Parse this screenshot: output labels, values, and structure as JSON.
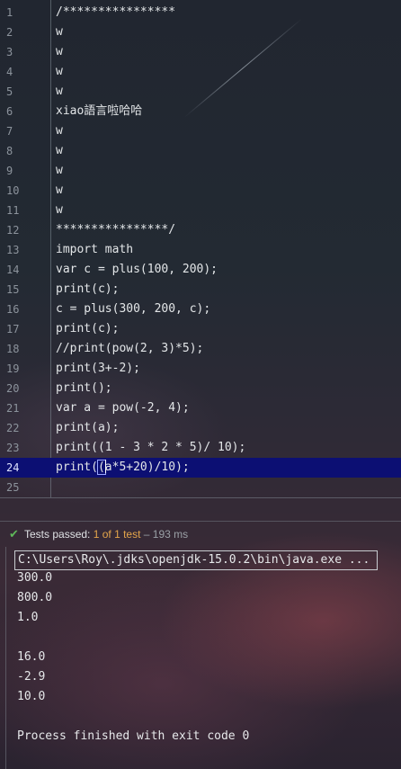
{
  "editor": {
    "current_line": 24,
    "lines": [
      {
        "n": "1",
        "code": "/****************"
      },
      {
        "n": "2",
        "code": "w"
      },
      {
        "n": "3",
        "code": "w"
      },
      {
        "n": "4",
        "code": "w"
      },
      {
        "n": "5",
        "code": "w"
      },
      {
        "n": "6",
        "code": "xiao語言啦哈哈"
      },
      {
        "n": "7",
        "code": "w"
      },
      {
        "n": "8",
        "code": "w"
      },
      {
        "n": "9",
        "code": "w"
      },
      {
        "n": "10",
        "code": "w"
      },
      {
        "n": "11",
        "code": "w"
      },
      {
        "n": "12",
        "code": "****************/"
      },
      {
        "n": "13",
        "code": "import math"
      },
      {
        "n": "14",
        "code": "var c = plus(100, 200);"
      },
      {
        "n": "15",
        "code": "print(c);"
      },
      {
        "n": "16",
        "code": "c = plus(300, 200, c);"
      },
      {
        "n": "17",
        "code": "print(c);"
      },
      {
        "n": "18",
        "code": "//print(pow(2, 3)*5);"
      },
      {
        "n": "19",
        "code": "print(3+-2);"
      },
      {
        "n": "20",
        "code": "print();"
      },
      {
        "n": "21",
        "code": "var a = pow(-2, 4);"
      },
      {
        "n": "22",
        "code": "print(a);"
      },
      {
        "n": "23",
        "code": "print((1 - 3 * 2 * 5)/ 10);"
      },
      {
        "n": "24",
        "code_before": "print(",
        "code_bracket": "(",
        "code_after": "a*5+20)/10);"
      },
      {
        "n": "25",
        "code": ""
      }
    ]
  },
  "run": {
    "status_prefix": "Tests passed: ",
    "status_count": "1 of 1 test",
    "status_time": " – 193 ms",
    "command": "C:\\Users\\Roy\\.jdks\\openjdk-15.0.2\\bin\\java.exe ...",
    "output": [
      "300.0",
      "800.0",
      "1.0",
      "",
      "16.0",
      "-2.9",
      "10.0",
      "",
      "Process finished with exit code 0"
    ]
  },
  "colors": {
    "current_line_bg": "#0c0f73",
    "pass_green": "#5fb85a",
    "count_orange": "#e5a64b"
  }
}
